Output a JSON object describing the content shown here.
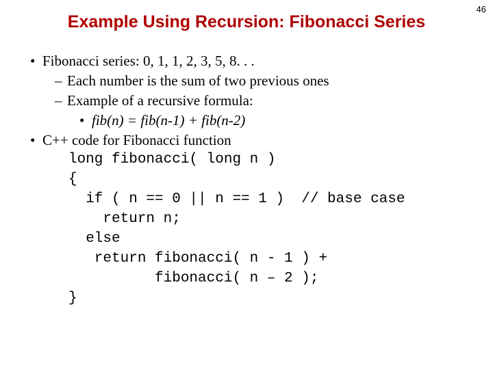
{
  "pageNumber": "46",
  "title": "Example Using Recursion: Fibonacci Series",
  "bullets": {
    "b1": "Fibonacci series: 0, 1, 1, 2, 3, 5, 8. . .",
    "b1a": "Each number is the sum of two previous ones",
    "b1b": "Example of a recursive formula:",
    "b1b1": "fib(n) = fib(n-1) + fib(n-2)",
    "b2": "C++ code for Fibonacci function"
  },
  "code": "long fibonacci( long n )\n{\n  if ( n == 0 || n == 1 )  // base case\n    return n;\n  else\n   return fibonacci( n - 1 ) +\n          fibonacci( n – 2 );\n}"
}
